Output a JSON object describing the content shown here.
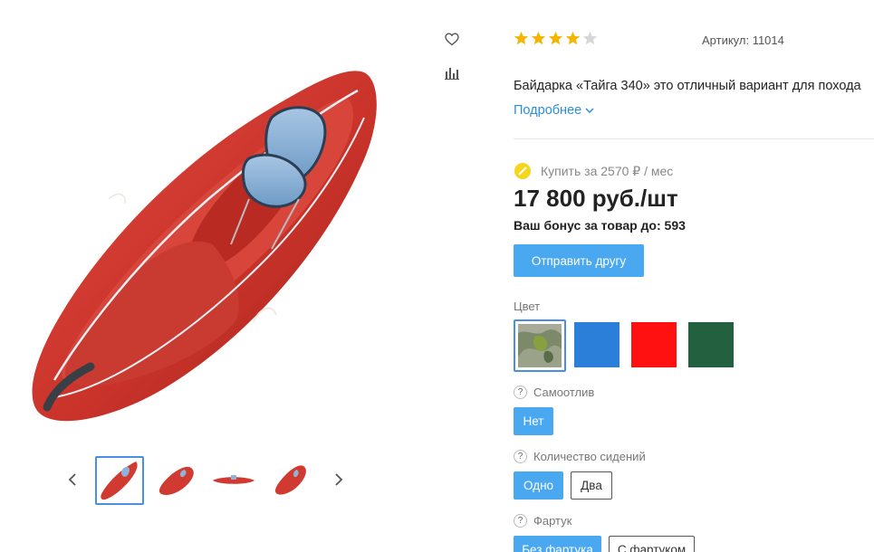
{
  "gallery": {
    "wishlist_icon": "heart-icon",
    "compare_icon": "bar-chart-icon",
    "main_image_alt": "kayak-image",
    "thumbnails": [
      {
        "view": "top-angle",
        "active": true
      },
      {
        "view": "front-angle",
        "active": false
      },
      {
        "view": "side",
        "active": false
      },
      {
        "view": "front-angle-2",
        "active": false
      }
    ]
  },
  "product": {
    "rating": 4,
    "rating_max": 5,
    "sku": "Артикул: 11014",
    "description": "Байдарка «Тайга 340» это отличный вариант для похода",
    "more_label": "Подробнее",
    "installment": "Купить за 2570 ₽ / мес",
    "price": "17 800 руб./шт",
    "bonus": "Ваш бонус за товар до: 593",
    "send_friend_label": "Отправить другу"
  },
  "options": {
    "color": {
      "label": "Цвет",
      "swatches": [
        {
          "name": "camo",
          "color": "#7d8a6a",
          "selected": true
        },
        {
          "name": "blue",
          "color": "#2b7fd8",
          "selected": false
        },
        {
          "name": "red",
          "color": "#ff1111",
          "selected": false
        },
        {
          "name": "green",
          "color": "#236040",
          "selected": false
        }
      ]
    },
    "self_drain": {
      "label": "Самоотлив",
      "help": "?",
      "values": [
        {
          "label": "Нет",
          "selected": true
        }
      ]
    },
    "seats": {
      "label": "Количество сидений",
      "help": "?",
      "values": [
        {
          "label": "Одно",
          "selected": true
        },
        {
          "label": "Два",
          "selected": false
        }
      ]
    },
    "apron": {
      "label": "Фартук",
      "help": "?",
      "values": [
        {
          "label": "Без фартука",
          "selected": true
        },
        {
          "label": "С фартуком",
          "selected": false
        }
      ]
    }
  }
}
